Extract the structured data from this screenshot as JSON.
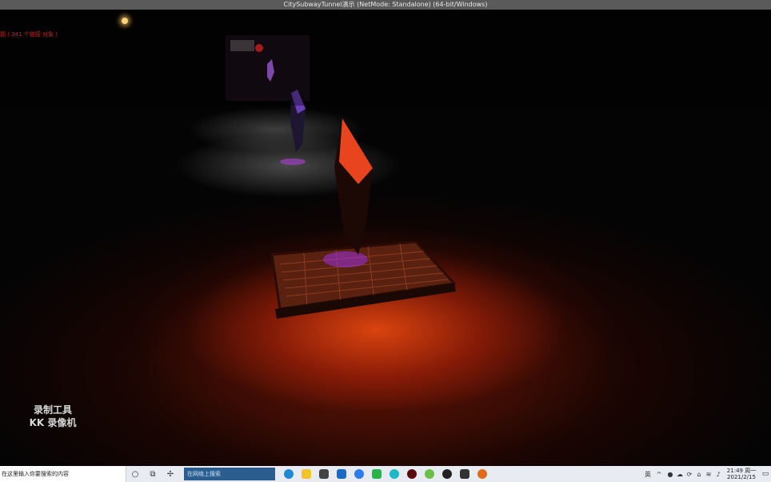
{
  "window": {
    "title": "CitySubwayTunnel演示 (NetMode: Standalone) (64-bit/Windows)"
  },
  "overlay": {
    "debug_text": "题 ( 341 个链接 对象 )",
    "watermark_line1": "录制工具",
    "watermark_line2": "KK 录像机"
  },
  "scene": {
    "crystal_near_color": "#e8451e",
    "crystal_far_color": "#7a3cc8",
    "floor_glow_color": "#c8320c",
    "grate_color": "#7a2a14"
  },
  "taskbar": {
    "search_placeholder": "在这里输入你要搜索的内容",
    "edge_search_placeholder": "在网络上搜索",
    "cortana_icon": "circle-icon",
    "task_view_icon": "task-view-icon",
    "tray_ime": "英",
    "clock_time": "21:49 周一",
    "clock_date": "2021/2/15"
  }
}
